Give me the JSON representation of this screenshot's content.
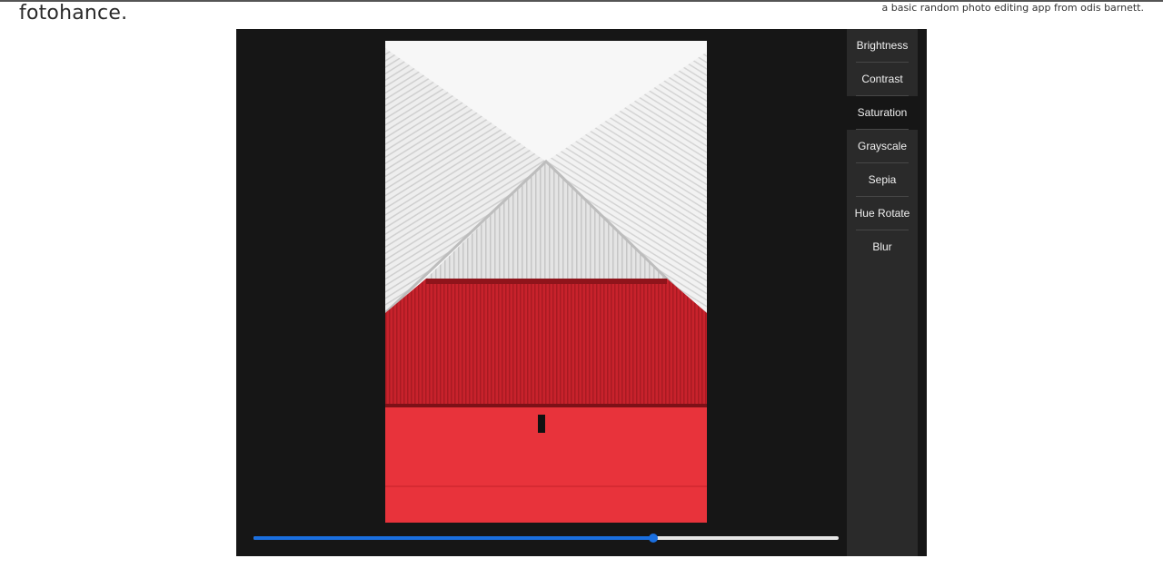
{
  "header": {
    "brand": "fotohance.",
    "tagline": "a basic random photo editing app from odis barnett."
  },
  "photo": {
    "alt": "Red and white corrugated metal building with a peaked roof"
  },
  "filters": [
    {
      "label": "Brightness",
      "active": false
    },
    {
      "label": "Contrast",
      "active": false
    },
    {
      "label": "Saturation",
      "active": true
    },
    {
      "label": "Grayscale",
      "active": false
    },
    {
      "label": "Sepia",
      "active": false
    },
    {
      "label": "Hue Rotate",
      "active": false
    },
    {
      "label": "Blur",
      "active": false
    }
  ],
  "slider": {
    "value_fraction": 0.683,
    "fill_color": "#1a6fe0",
    "track_color": "#e6e6e6"
  }
}
